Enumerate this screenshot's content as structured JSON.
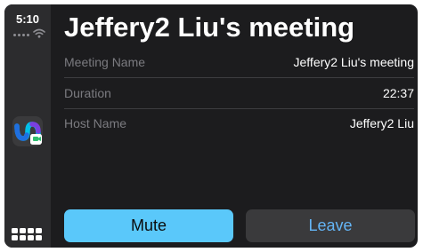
{
  "status": {
    "time": "5:10"
  },
  "meeting": {
    "title": "Jeffery2 Liu's meeting",
    "rows": [
      {
        "label": "Meeting Name",
        "value": "Jeffery2 Liu's meeting"
      },
      {
        "label": "Duration",
        "value": "22:37"
      },
      {
        "label": "Host Name",
        "value": "Jeffery2 Liu"
      }
    ]
  },
  "actions": {
    "mute_label": "Mute",
    "leave_label": "Leave"
  },
  "icons": {
    "app": "webex-app-icon",
    "signal": "cellular-signal-icon",
    "wifi": "wifi-icon",
    "dashboard": "app-grid-icon"
  },
  "colors": {
    "background": "#1c1c1e",
    "sidebar": "#2c2c2e",
    "mute_button": "#5ac8fa",
    "leave_button": "#3a3a3c",
    "leave_text": "#64b5f6"
  }
}
